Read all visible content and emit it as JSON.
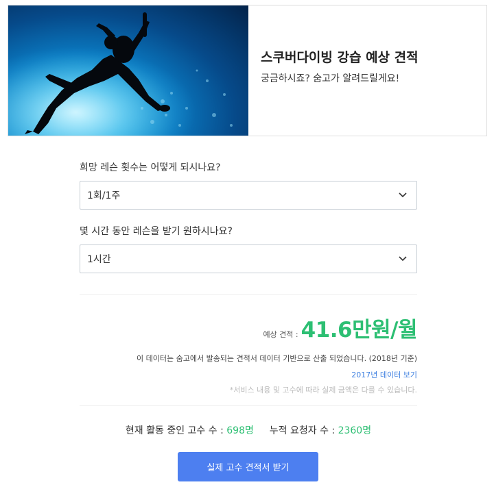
{
  "hero": {
    "title": "스쿠버다이빙 강습 예상 견적",
    "subtitle": "궁금하시죠? 숨고가 알려드릴게요!",
    "photo_icon": "scuba-diver-silhouette"
  },
  "questions": [
    {
      "label": "희망 레슨 횟수는 어떻게 되시나요?",
      "selected": "1회/1주"
    },
    {
      "label": "몇 시간 동안 레슨을 받기 원하시나요?",
      "selected": "1시간"
    }
  ],
  "estimate": {
    "label": "예상 견적 :",
    "value": "41.6만원/월",
    "note": "이 데이터는 숨고에서 발송되는 견적서 데이터 기반으로 산출 되었습니다. (2018년 기준)",
    "link": "2017년 데이터 보기",
    "disclaimer": "*서비스 내용 및 고수에 따라 실제 금액은 다를 수 있습니다."
  },
  "stats": {
    "active_label": "현재 활동 중인 고수 수 :",
    "active_value": "698명",
    "requests_label": "누적 요청자 수 :",
    "requests_value": "2360명"
  },
  "cta": {
    "label": "실제 고수 견적서 받기"
  },
  "colors": {
    "accent_green": "#2dbf73",
    "link_blue": "#3d7fe0",
    "cta_blue": "#4d7ff0"
  }
}
